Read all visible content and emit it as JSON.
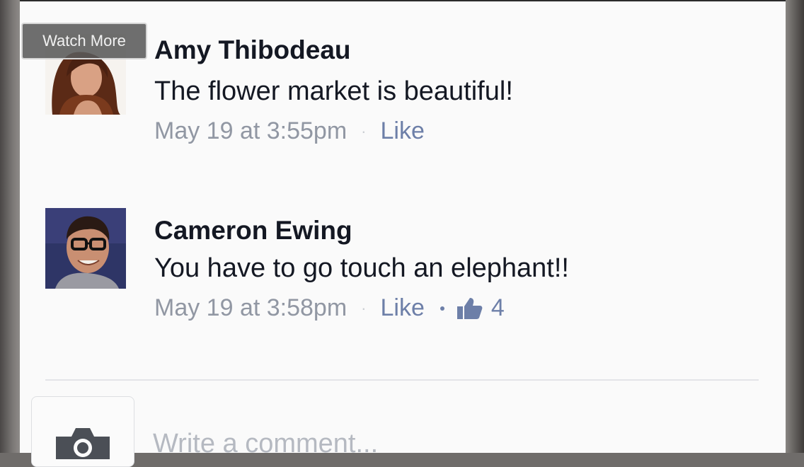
{
  "overlay": {
    "watch_more_label": "Watch More"
  },
  "comments": [
    {
      "author": "Amy Thibodeau",
      "text": "The flower market is beautiful!",
      "timestamp": "May 19 at 3:55pm",
      "like_label": "Like"
    },
    {
      "author": "Cameron Ewing",
      "text": "You have to go touch an elephant!!",
      "timestamp": "May 19 at 3:58pm",
      "like_label": "Like",
      "like_count": "4"
    }
  ],
  "composer": {
    "placeholder": "Write a comment..."
  },
  "colors": {
    "link": "#6d7fa8",
    "meta": "#9197a3",
    "text": "#141823"
  },
  "icons": {
    "camera": "camera-icon",
    "thumbs_up": "thumbs-up-icon"
  }
}
